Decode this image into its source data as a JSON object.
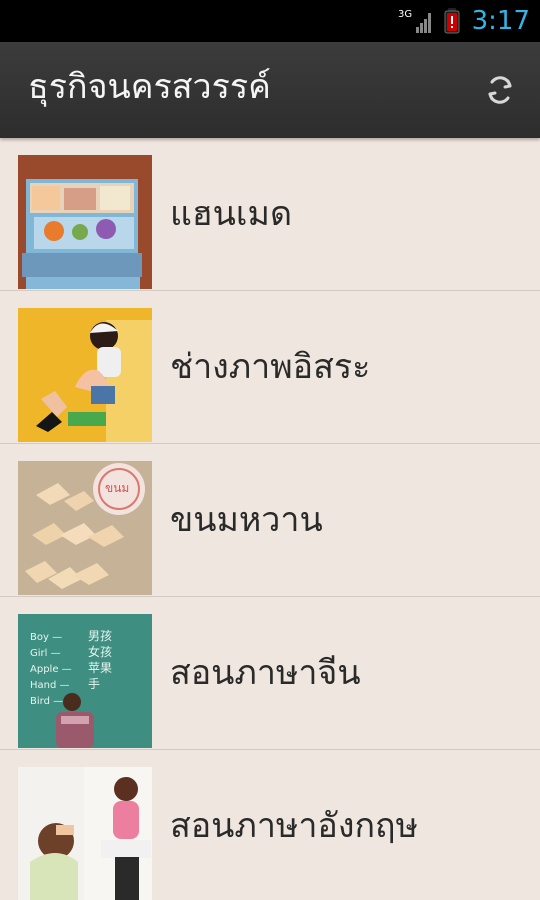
{
  "status_bar": {
    "time": "3:17",
    "network": "3G",
    "colors": {
      "accent": "#33b5e5",
      "warning": "#cc0000"
    },
    "icons": [
      "signal-3g-icon",
      "battery-warning-icon"
    ]
  },
  "action_bar": {
    "title": "ธุรกิจนครสวรรค์",
    "refresh_icon": "refresh-icon"
  },
  "list": {
    "items": [
      {
        "label": "แฮนเมด",
        "thumbnail_icon": "handmade-thumbnail"
      },
      {
        "label": "ช่างภาพอิสระ",
        "thumbnail_icon": "photographer-thumbnail"
      },
      {
        "label": "ขนมหวาน",
        "thumbnail_icon": "dessert-thumbnail"
      },
      {
        "label": "สอนภาษาจีน",
        "thumbnail_icon": "chinese-lesson-thumbnail"
      },
      {
        "label": "สอนภาษาอังกฤษ",
        "thumbnail_icon": "english-lesson-thumbnail"
      }
    ]
  },
  "theme": {
    "background": "#efe7df",
    "action_bar": "#2d2d2d"
  }
}
